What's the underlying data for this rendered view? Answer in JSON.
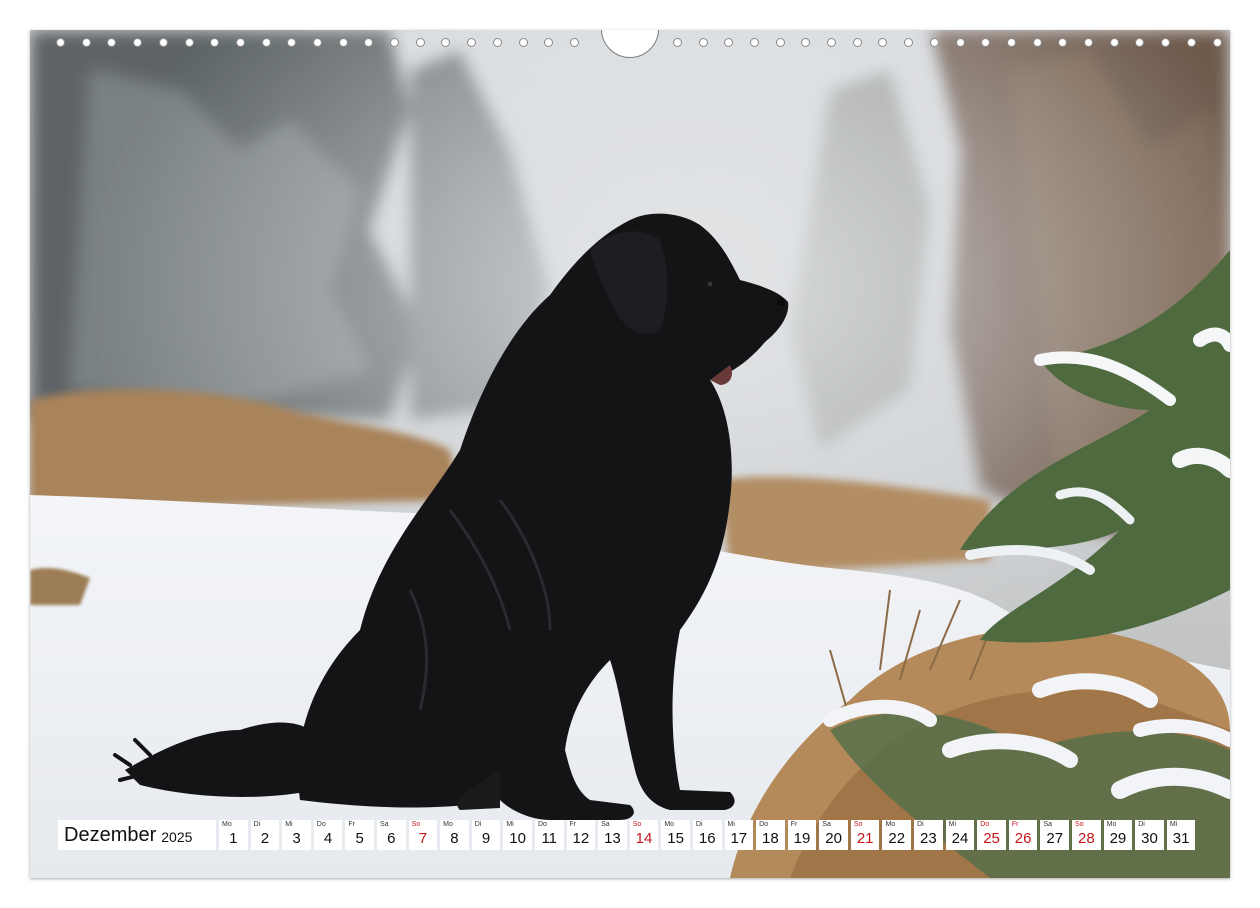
{
  "calendar": {
    "month": "Dezember",
    "year": "2025",
    "days": [
      {
        "wd": "Mo",
        "n": "1"
      },
      {
        "wd": "Di",
        "n": "2"
      },
      {
        "wd": "Mi",
        "n": "3"
      },
      {
        "wd": "Do",
        "n": "4"
      },
      {
        "wd": "Fr",
        "n": "5"
      },
      {
        "wd": "Sa",
        "n": "6"
      },
      {
        "wd": "So",
        "n": "7",
        "holiday": true
      },
      {
        "wd": "Mo",
        "n": "8"
      },
      {
        "wd": "Di",
        "n": "9"
      },
      {
        "wd": "Mi",
        "n": "10"
      },
      {
        "wd": "Do",
        "n": "11"
      },
      {
        "wd": "Fr",
        "n": "12"
      },
      {
        "wd": "Sa",
        "n": "13"
      },
      {
        "wd": "So",
        "n": "14",
        "holiday": true
      },
      {
        "wd": "Mo",
        "n": "15"
      },
      {
        "wd": "Di",
        "n": "16"
      },
      {
        "wd": "Mi",
        "n": "17"
      },
      {
        "wd": "Do",
        "n": "18"
      },
      {
        "wd": "Fr",
        "n": "19"
      },
      {
        "wd": "Sa",
        "n": "20"
      },
      {
        "wd": "So",
        "n": "21",
        "holiday": true
      },
      {
        "wd": "Mo",
        "n": "22"
      },
      {
        "wd": "Di",
        "n": "23"
      },
      {
        "wd": "Mi",
        "n": "24"
      },
      {
        "wd": "Do",
        "n": "25",
        "holiday": true
      },
      {
        "wd": "Fr",
        "n": "26",
        "holiday": true
      },
      {
        "wd": "Sa",
        "n": "27"
      },
      {
        "wd": "So",
        "n": "28",
        "holiday": true
      },
      {
        "wd": "Mo",
        "n": "29"
      },
      {
        "wd": "Di",
        "n": "30"
      },
      {
        "wd": "Mi",
        "n": "31"
      }
    ]
  },
  "colors": {
    "holiday": "#c4161c",
    "dog": "#141416",
    "snow": "#f1f3f6",
    "dry_grass": "#b48a5a",
    "fir_green": "#4e6a3e"
  },
  "photo": {
    "subject": "black-dog-icon"
  }
}
